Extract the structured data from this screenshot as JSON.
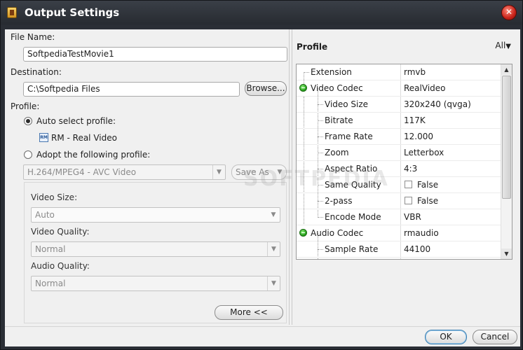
{
  "window": {
    "title": "Output Settings"
  },
  "left": {
    "file_name_label": "File Name:",
    "file_name_value": "SoftpediaTestMovie1",
    "destination_label": "Destination:",
    "destination_value": "C:\\Softpedia Files",
    "browse_label": "Browse...",
    "profile_label": "Profile:",
    "auto_select_label": "Auto select profile:",
    "auto_profile_name": "RM - Real Video",
    "rm_icon_text": "RM",
    "adopt_label": "Adopt the following profile:",
    "profile_combo_value": "H.264/MPEG4 - AVC Video",
    "save_as_label": "Save As",
    "video_size_label": "Video Size:",
    "video_size_value": "Auto",
    "video_quality_label": "Video Quality:",
    "video_quality_value": "Normal",
    "audio_quality_label": "Audio Quality:",
    "audio_quality_value": "Normal",
    "more_label": "More <<"
  },
  "right": {
    "header": "Profile",
    "filter": "All",
    "rows": [
      {
        "name": "Extension",
        "value": "rmvb"
      },
      {
        "name": "Video Codec",
        "value": "RealVideo"
      },
      {
        "name": "Video Size",
        "value": "320x240 (qvga)"
      },
      {
        "name": "Bitrate",
        "value": "117K"
      },
      {
        "name": "Frame Rate",
        "value": "12.000"
      },
      {
        "name": "Zoom",
        "value": "Letterbox"
      },
      {
        "name": "Aspect Ratio",
        "value": "4:3"
      },
      {
        "name": "Same Quality",
        "value": "False"
      },
      {
        "name": "2-pass",
        "value": "False"
      },
      {
        "name": "Encode Mode",
        "value": "VBR"
      },
      {
        "name": "Audio Codec",
        "value": "rmaudio"
      },
      {
        "name": "Sample Rate",
        "value": "44100"
      }
    ]
  },
  "footer": {
    "ok_label": "OK",
    "cancel_label": "Cancel"
  },
  "watermark": "SOFTPEDIA",
  "colors": {
    "title_bar": "#2a2e35",
    "close_button": "#c8231a",
    "expand_icon": "#1f9a16",
    "panel": "#f0f0f0"
  }
}
